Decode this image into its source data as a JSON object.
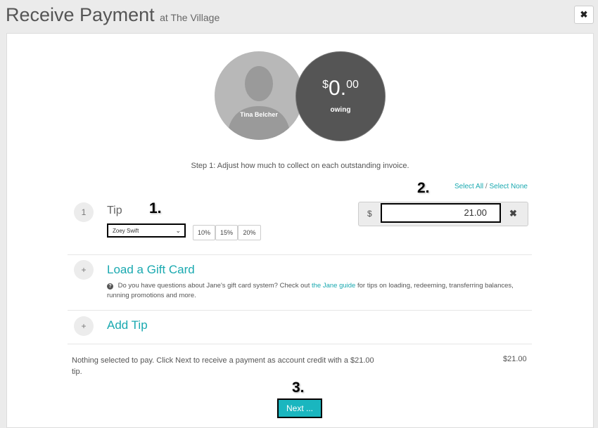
{
  "header": {
    "title": "Receive Payment",
    "subtitle": "at The Village",
    "close_icon": "close-icon"
  },
  "summary_circles": {
    "patient_name": "Tina Belcher",
    "owing_symbol": "$",
    "owing_whole": "0.",
    "owing_cents": "00",
    "owing_label": "owing"
  },
  "step1_text": "Step 1: Adjust how much to collect on each outstanding invoice.",
  "select_links": {
    "all": "Select All",
    "separator": "/",
    "none": "Select None"
  },
  "annotations": [
    "1.",
    "2.",
    "3."
  ],
  "tip_row": {
    "number": "1",
    "label": "Tip",
    "staff_selected": "Zoey Swift",
    "presets": [
      "10%",
      "15%",
      "20%"
    ],
    "currency_symbol": "$",
    "amount": "21.00",
    "clear_icon": "times-icon"
  },
  "gift_card": {
    "button": "+",
    "title": "Load a Gift Card",
    "info_prefix": "Do you have questions about Jane's gift card system? Check out",
    "info_link": "the Jane guide",
    "info_suffix": "for tips on loading, redeeming, transferring balances, running promotions and more."
  },
  "add_tip": {
    "button": "+",
    "title": "Add Tip"
  },
  "footer": {
    "summary": "Nothing selected to pay. Click Next to receive a payment as account credit with a $21.00 tip.",
    "total": "$21.00",
    "next_label": "Next ..."
  },
  "colors": {
    "accent": "#1aa9b0",
    "next_button": "#1ab6bf",
    "owing_circle": "#555555"
  }
}
